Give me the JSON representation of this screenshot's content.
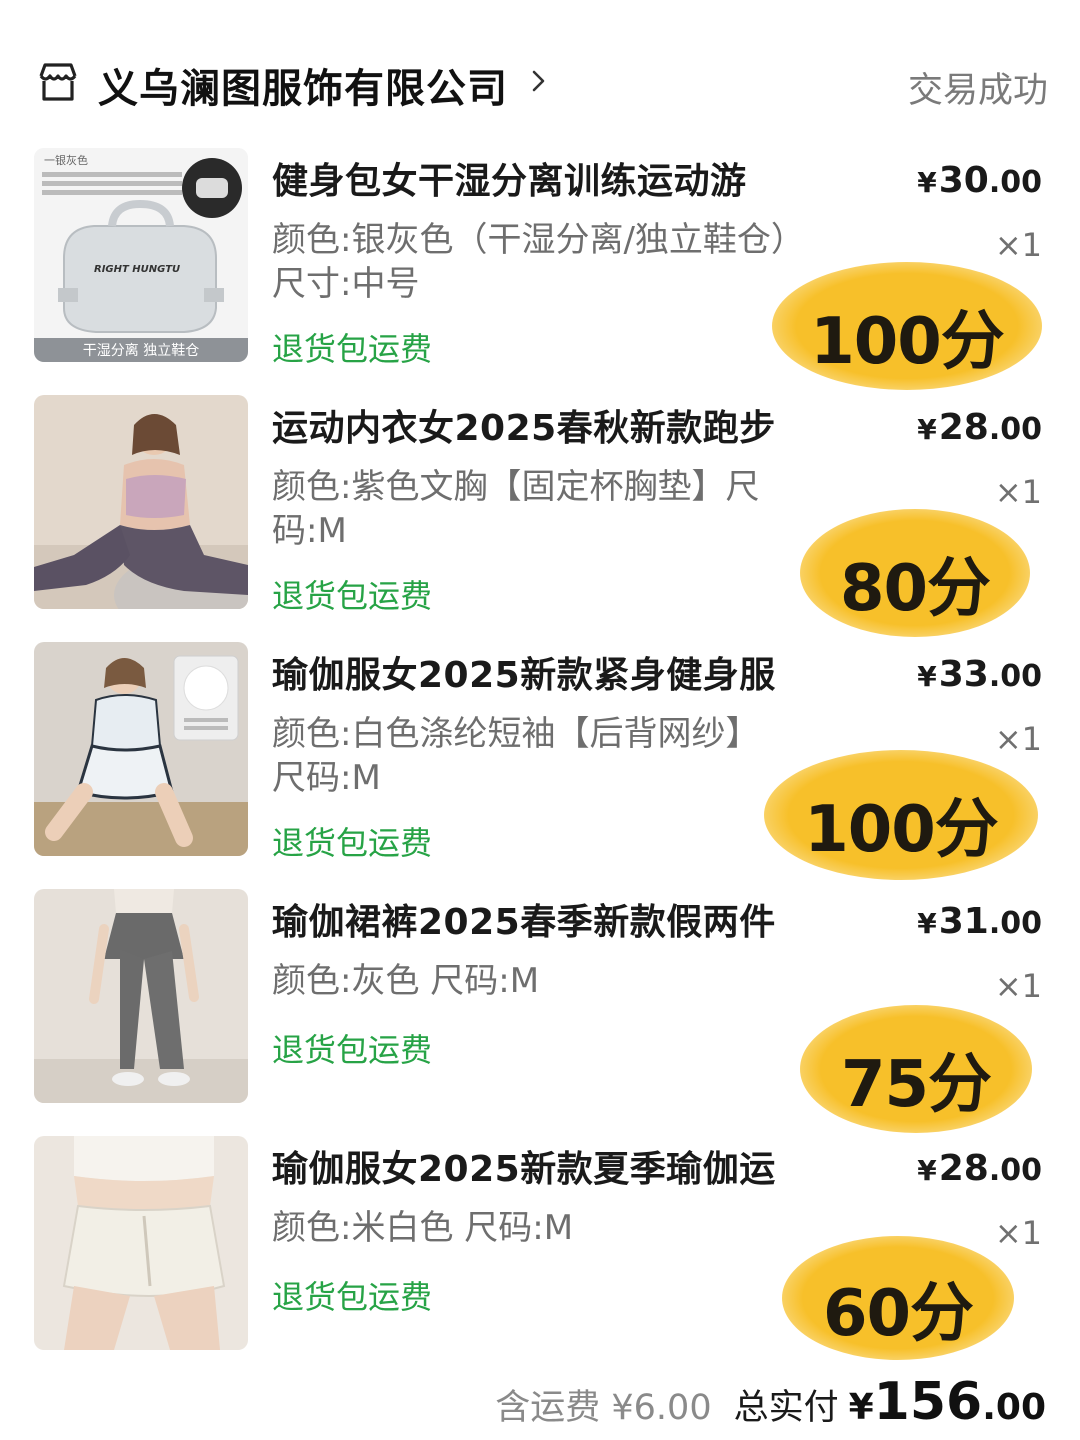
{
  "header": {
    "store_name": "义乌澜图服饰有限公司",
    "status": "交易成功",
    "icons": {
      "store": "store-icon",
      "chevron": "chevron-right-icon"
    }
  },
  "items": [
    {
      "title": "健身包女干湿分离训练运动游",
      "spec": "颜色:银灰色（干湿分离/独立鞋仓）尺寸:中号",
      "tag": "退货包运费",
      "price_symbol": "¥",
      "price_int": "30",
      "price_dec": ".00",
      "qty": "×1",
      "score": "100分",
      "thumb_text": {
        "top": "一银灰色",
        "bottom": "干湿分离 独立鞋仓",
        "logo": "RIGHT HUNGTU"
      }
    },
    {
      "title": "运动内衣女2025春秋新款跑步",
      "spec": "颜色:紫色文胸【固定杯胸垫】尺码:M",
      "tag": "退货包运费",
      "price_symbol": "¥",
      "price_int": "28",
      "price_dec": ".00",
      "qty": "×1",
      "score": "80分"
    },
    {
      "title": "瑜伽服女2025新款紧身健身服",
      "spec": "颜色:白色涤纶短袖【后背网纱】尺码:M",
      "tag": "退货包运费",
      "price_symbol": "¥",
      "price_int": "33",
      "price_dec": ".00",
      "qty": "×1",
      "score": "100分"
    },
    {
      "title": "瑜伽裙裤2025春季新款假两件",
      "spec": "颜色:灰色 尺码:M",
      "tag": "退货包运费",
      "price_symbol": "¥",
      "price_int": "31",
      "price_dec": ".00",
      "qty": "×1",
      "score": "75分"
    },
    {
      "title": "瑜伽服女2025新款夏季瑜伽运",
      "spec": "颜色:米白色 尺码:M",
      "tag": "退货包运费",
      "price_symbol": "¥",
      "price_int": "28",
      "price_dec": ".00",
      "qty": "×1",
      "score": "60分"
    }
  ],
  "footer": {
    "shipping": "含运费 ¥6.00",
    "total_label": "总实付",
    "total_symbol": "¥",
    "total_int": "156",
    "total_dec": ".00"
  },
  "colors": {
    "accent_green": "#27a346",
    "score_highlight": "#f7c02a",
    "muted_text": "#6e6e6e"
  }
}
